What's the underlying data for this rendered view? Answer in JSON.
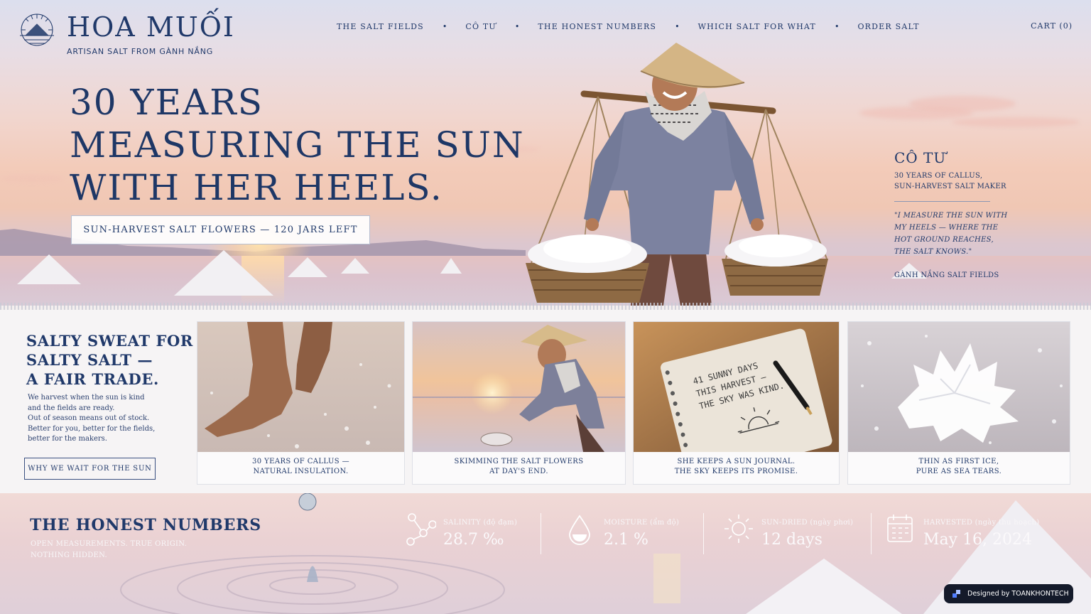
{
  "brand": {
    "name": "HOA MUỐI",
    "tagline": "ARTISAN SALT FROM GÀNH NẮNG",
    "logo_icon": "salt-pile-sun-logo"
  },
  "nav": {
    "items": [
      "THE SALT FIELDS",
      "CÔ TƯ",
      "THE HONEST NUMBERS",
      "WHICH SALT FOR WHAT",
      "ORDER SALT"
    ],
    "separator": "•",
    "cart": "CART (0)"
  },
  "hero": {
    "headline": [
      "30 YEARS",
      "MEASURING THE SUN",
      "WITH HER HEELS."
    ],
    "cta": "SUN-HARVEST SALT FLOWERS — 120 JARS LEFT"
  },
  "profile": {
    "name": "CÔ TƯ",
    "role": [
      "30 YEARS OF CALLUS,",
      "SUN-HARVEST SALT MAKER"
    ],
    "quote": [
      "\"I MEASURE THE SUN WITH",
      "MY HEELS — WHERE THE",
      "HOT GROUND REACHES,",
      "THE SALT KNOWS.\""
    ],
    "location": "GÀNH NẮNG SALT FIELDS"
  },
  "fair_trade": {
    "title": [
      "SALTY SWEAT FOR",
      "SALTY SALT —",
      "A FAIR TRADE."
    ],
    "body": [
      "We harvest when the sun is kind",
      "and the fields are ready.",
      "Out of season means out of stock.",
      "Better for you, better for the fields,",
      "better for the makers."
    ],
    "cta": "WHY WE WAIT FOR THE SUN"
  },
  "cards": [
    {
      "caption": [
        "30 YEARS OF CALLUS —",
        "NATURAL INSULATION."
      ],
      "image": "bare-feet-on-salt"
    },
    {
      "caption": [
        "SKIMMING THE SALT FLOWERS",
        "AT DAY'S END."
      ],
      "image": "woman-skimming-salt"
    },
    {
      "caption": [
        "SHE KEEPS A SUN JOURNAL.",
        "THE SKY KEEPS ITS PROMISE."
      ],
      "image": "sun-journal-notebook",
      "note": [
        "41 SUNNY DAYS",
        "THIS HARVEST —",
        "THE SKY WAS KIND."
      ]
    },
    {
      "caption": [
        "THIN AS FIRST ICE,",
        "PURE AS SEA TEARS."
      ],
      "image": "salt-crystal-flower"
    }
  ],
  "numbers": {
    "title": "THE HONEST NUMBERS",
    "subtitle": [
      "OPEN MEASUREMENTS. TRUE ORIGIN.",
      "NOTHING HIDDEN."
    ],
    "stats": [
      {
        "label": "SALINITY (độ đạm)",
        "value": "28.7 ‰",
        "icon": "molecule-icon"
      },
      {
        "label": "MOISTURE (ẩm độ)",
        "value": "2.1 %",
        "icon": "water-drop-icon"
      },
      {
        "label": "SUN-DRIED (ngày phơi)",
        "value": "12 days",
        "icon": "sun-icon"
      },
      {
        "label": "HARVESTED (ngày thu hoạch)",
        "value": "May 16, 2024",
        "icon": "calendar-icon"
      }
    ]
  },
  "badge": {
    "text": "Designed by TOANKHONTECH"
  },
  "colors": {
    "navy": "#20396a",
    "sunset": "#f3cbb9",
    "salt": "#f2f0f3"
  }
}
